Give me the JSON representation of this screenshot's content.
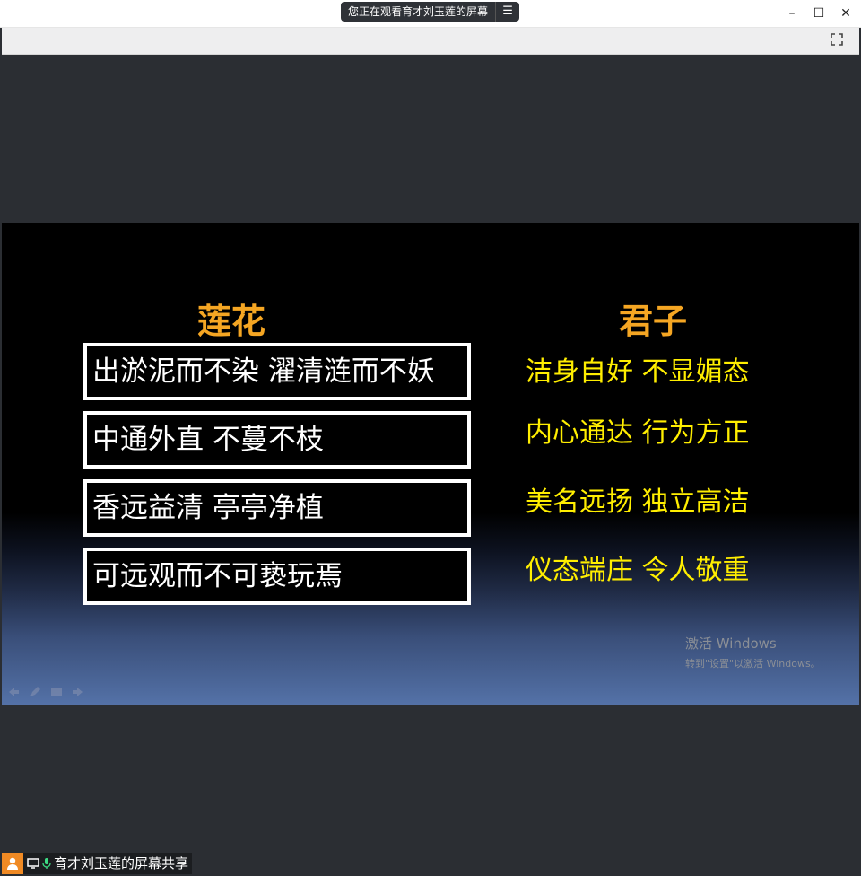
{
  "window": {
    "share_title": "您正在观看育才刘玉莲的屏幕",
    "menu_icon": "☰"
  },
  "controls": {
    "minimize": "–",
    "maximize": "☐",
    "close": "✕"
  },
  "slide": {
    "left_heading": "莲花",
    "right_heading": "君子",
    "left_items": [
      "出淤泥而不染  濯清涟而不妖",
      "中通外直  不蔓不枝",
      "香远益清  亭亭净植",
      "可远观而不可亵玩焉"
    ],
    "right_items": [
      "洁身自好  不显媚态",
      "内心通达  行为方正",
      "美名远扬  独立高洁",
      "仪态端庄  令人敬重"
    ],
    "watermark_line1": "激活 Windows",
    "watermark_line2": "转到\"设置\"以激活 Windows。"
  },
  "bottom": {
    "presenter_label": "育才刘玉莲的屏幕共享"
  },
  "colors": {
    "heading": "#f5a623",
    "right_text": "#ffee00",
    "box_border": "#ffffff",
    "avatar": "#f08a24"
  }
}
